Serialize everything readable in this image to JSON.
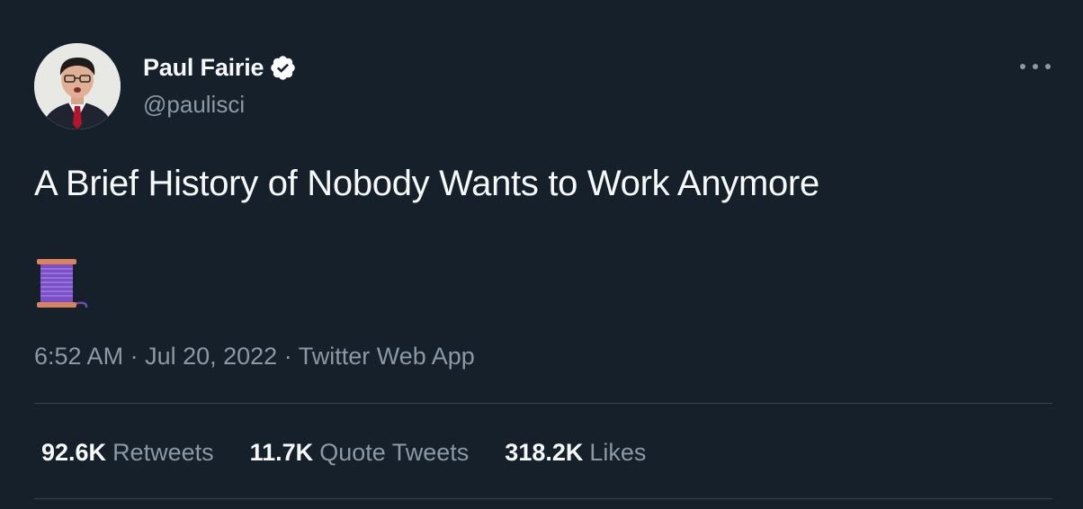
{
  "author": {
    "display_name": "Paul Fairie",
    "handle": "@paulisci",
    "verified": true,
    "avatar_icon": "profile-photo-avatar"
  },
  "tweet": {
    "text": "A Brief History of Nobody Wants to Work Anymore",
    "emoji_icon": "thread-spool-emoji"
  },
  "meta": {
    "time": "6:52 AM",
    "separator_1": "·",
    "date": "Jul 20, 2022",
    "separator_2": "·",
    "source": "Twitter Web App"
  },
  "stats": {
    "retweets_count": "92.6K",
    "retweets_label": "Retweets",
    "quotes_count": "11.7K",
    "quotes_label": "Quote Tweets",
    "likes_count": "318.2K",
    "likes_label": "Likes"
  },
  "colors": {
    "background": "#15202b",
    "primary_text": "#f7f9f9",
    "secondary_text": "#8b98a5",
    "divider": "#38444d",
    "verified_badge": "#ffffff"
  }
}
